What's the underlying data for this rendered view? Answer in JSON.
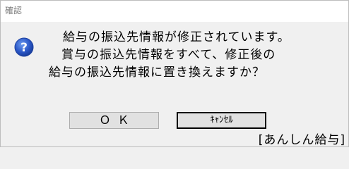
{
  "window": {
    "title": "確認"
  },
  "message": {
    "line1": "給与の振込先情報が修正されています。",
    "line2": "賞与の振込先情報をすべて、修正後の",
    "line3": "給与の振込先情報に置き換えますか？"
  },
  "icon": {
    "name": "question-icon",
    "color": "#2a56c6"
  },
  "buttons": {
    "ok_label": "ＯＫ",
    "cancel_label": "ｷｬﾝｾﾙ"
  },
  "brand": {
    "label": "[あんしん給与]"
  }
}
